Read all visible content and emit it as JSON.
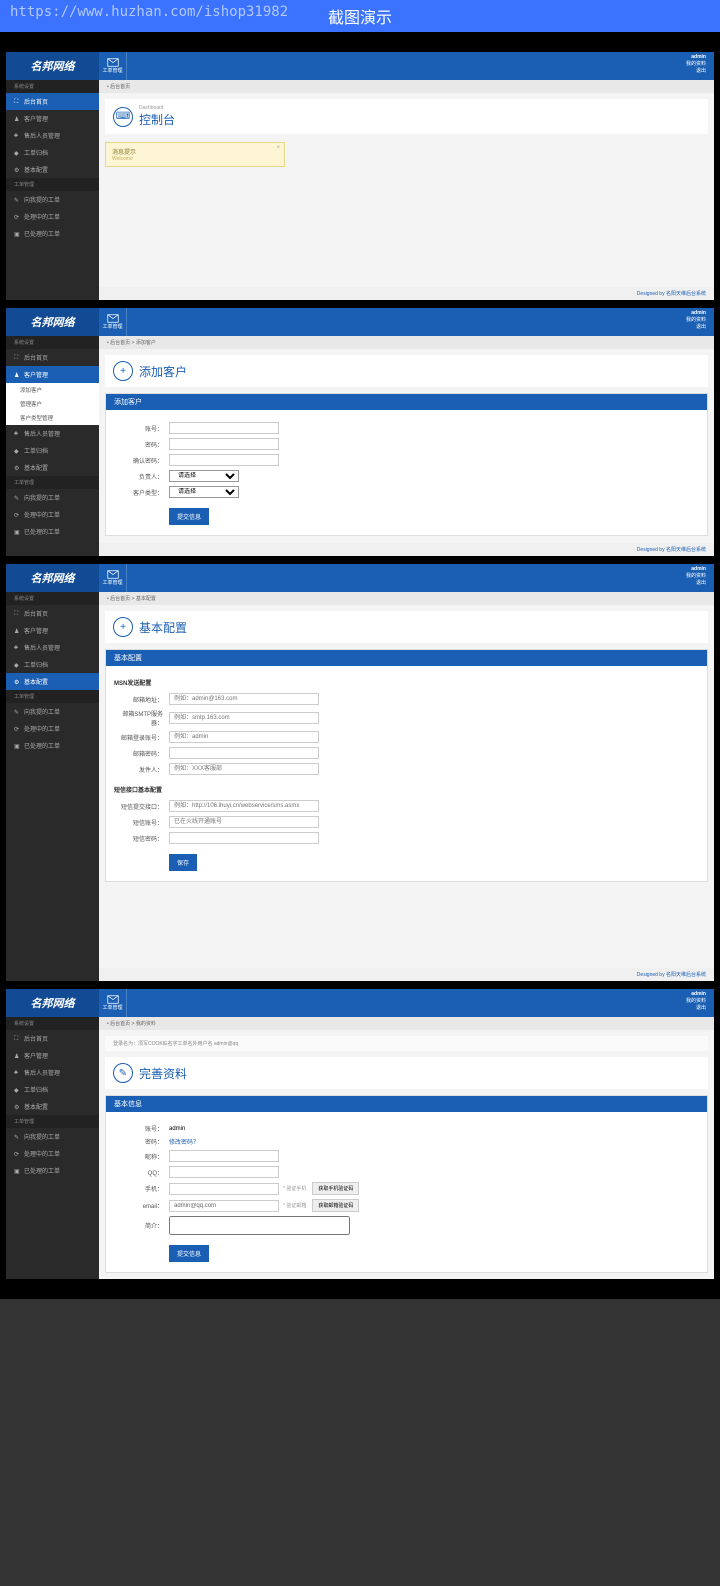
{
  "banner": {
    "title": "截图演示",
    "url": "https://www.huzhan.com/ishop31982"
  },
  "shared": {
    "logo": "名邦网络",
    "mail": "工单管理",
    "user": {
      "name": "admin",
      "link1": "我的资料",
      "link2": "退出"
    },
    "footer_label": "Designed by ",
    "footer_link": "名阳天维后台系统"
  },
  "s1": {
    "navh1": "系统设置",
    "navh2": "工单管理",
    "nav": [
      "后台首页",
      "客户管理",
      "售后人员管理",
      "工单归档",
      "基本配置"
    ],
    "tnav": [
      "向我提的工单",
      "处理中的工单",
      "已处理的工单"
    ],
    "crumb": "• 后台首页",
    "pgsub": "Dashboard",
    "pgtitle": "控制台",
    "alert_t": "消息提示",
    "alert_b": "Welcome"
  },
  "s2": {
    "crumb": "• 后台首页 > 添加客户",
    "pgtitle": "添加客户",
    "panel_t": "添加客户",
    "nav_active": "客户管理",
    "subs": [
      "添加客户",
      "管理客户",
      "客户类型管理"
    ],
    "f": {
      "l1": "账号：",
      "l2": "密码：",
      "l3": "确认密码：",
      "l4": "负责人：",
      "l5": "客户类型：",
      "sel": "请选择",
      "btn": "提交信息"
    }
  },
  "s3": {
    "crumb": "• 后台首页 > 基本配置",
    "pgtitle": "基本配置",
    "panel_t": "基本配置",
    "nav_active": "基本配置",
    "sec1": "MSN发送配置",
    "sec2": "短信接口基本配置",
    "f1": {
      "l": "邮箱地址：",
      "p": "例如：admin@163.com"
    },
    "f2": {
      "l": "邮箱SMTP服务器：",
      "p": "例如：smtp.163.com"
    },
    "f3": {
      "l": "邮箱登录账号：",
      "p": "例如：admin"
    },
    "f4": {
      "l": "邮箱密码：",
      "p": ""
    },
    "f5": {
      "l": "发件人：",
      "p": "例如：XXX客服部"
    },
    "f6": {
      "l": "短信提交接口：",
      "p": "例如：http://106.ihuyi.cn/webservice/sms.asmx"
    },
    "f7": {
      "l": "短信账号：",
      "p": "已在火线开通账号"
    },
    "f8": {
      "l": "短信密码：",
      "p": ""
    },
    "btn": "保存"
  },
  "s4": {
    "crumb": "• 后台首页 > 我的资料",
    "note": "登录名为：须写COOKIE名字工单名外用户名  admin@qq",
    "pgtitle": "完善资料",
    "panel_t": "基本信息",
    "f": {
      "l1": "账号：",
      "v1": "admin",
      "l2": "密码：",
      "lk": "修改密码？",
      "l3": "昵称：",
      "l4": "QQ：",
      "l5": "手机：",
      "l6": "email：",
      "v6": "admin@qq.com",
      "l7": "简介："
    },
    "tip1": "* 验证手机",
    "btn1": "获取手机验证码",
    "tip2": "* 验证邮箱",
    "btn2": "获取邮箱验证码",
    "btn": "提交信息"
  }
}
